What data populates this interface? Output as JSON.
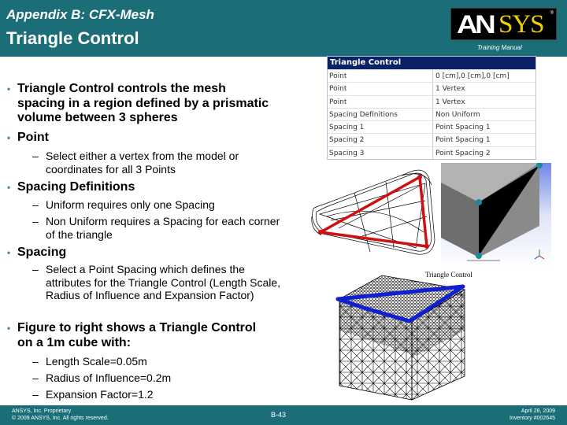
{
  "header": {
    "subtitle": "Appendix B: CFX-Mesh",
    "title": "Triangle Control",
    "logo": {
      "left": "AN",
      "right": "SYS",
      "registered": "®"
    },
    "training_label": "Training Manual",
    "colors": {
      "band": "#1b6e78",
      "logo_yellow": "#f0d000"
    }
  },
  "bullets": [
    {
      "text": "Triangle Control controls the mesh spacing in a region defined by a prismatic volume between 3 spheres"
    },
    {
      "text": "Point",
      "sub": [
        "Select either a vertex from the model or coordinates for all 3 Points"
      ]
    },
    {
      "text": "Spacing Definitions",
      "sub": [
        "Uniform requires only one Spacing",
        "Non Uniform requires a Spacing for each corner of the triangle"
      ]
    },
    {
      "text": "Spacing",
      "sub": [
        "Select a Point Spacing which defines the attributes for the Triangle Control (Length Scale, Radius of Influence and Expansion Factor)"
      ]
    },
    {
      "text": "Figure to right shows a Triangle Control on a 1m cube with:",
      "sub": [
        "Length Scale=0.05m",
        "Radius of Influence=0.2m",
        "Expansion Factor=1.2"
      ]
    }
  ],
  "bullet_icon": "bullet-dot",
  "sub_icon": "dash",
  "details_table": {
    "title": "Triangle Control",
    "rows": [
      {
        "key": "Point",
        "value": "0 [cm],0 [cm],0 [cm]"
      },
      {
        "key": "Point",
        "value": "1 Vertex"
      },
      {
        "key": "Point",
        "value": "1 Vertex"
      },
      {
        "key": "Spacing Definitions",
        "value": "Non Uniform"
      },
      {
        "key": "Spacing 1",
        "value": "Point Spacing 1"
      },
      {
        "key": "Spacing 2",
        "value": "Point Spacing 1"
      },
      {
        "key": "Spacing 3",
        "value": "Point Spacing 2"
      }
    ],
    "header_color": "#0a2166"
  },
  "figures": {
    "wireframe": {
      "description": "triangle-wireframe",
      "edge_color": "#d01010"
    },
    "cube": {
      "description": "cube-with-triangle",
      "vertex_color": "#1a8a9a"
    },
    "mesh": {
      "label": "Triangle Control",
      "triangle_color": "#1020d0"
    }
  },
  "footer": {
    "left_line1": "ANSYS, Inc. Proprietary",
    "left_line2": "© 2009 ANSYS, Inc.  All rights reserved.",
    "page": "B-43",
    "right_line1": "April 28, 2009",
    "right_line2": "Inventory #002645"
  }
}
